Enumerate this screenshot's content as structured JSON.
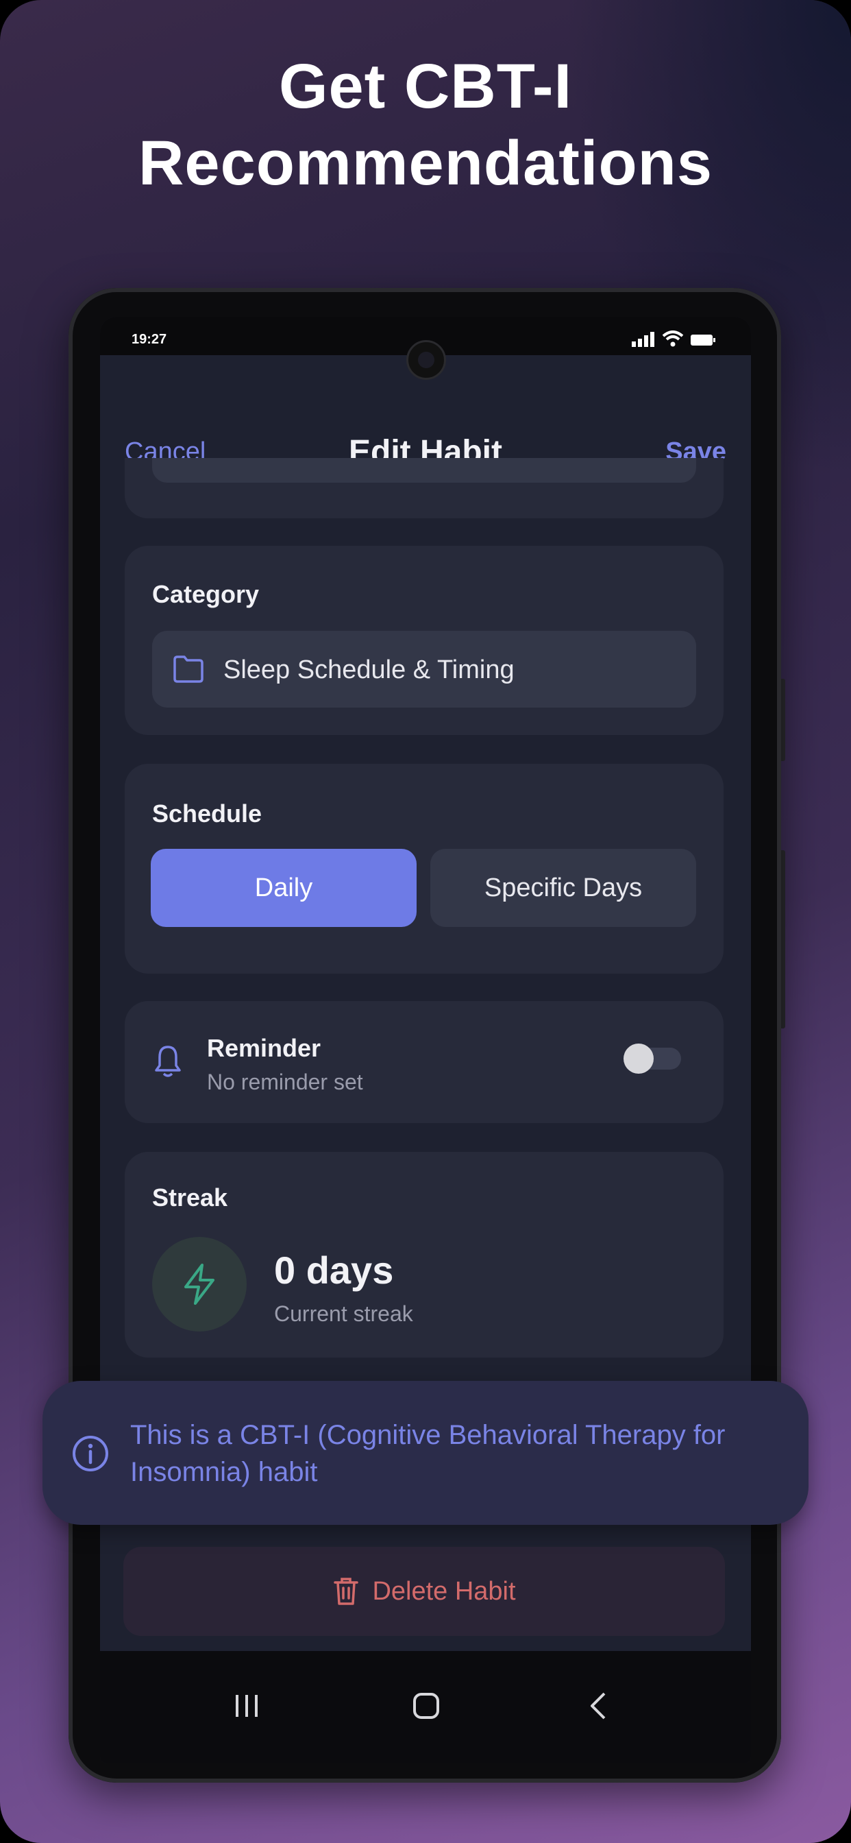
{
  "headline": {
    "line1": "Get CBT-I",
    "line2": "Recommendations"
  },
  "status_bar": {
    "time": "19:27"
  },
  "nav": {
    "cancel": "Cancel",
    "title": "Edit Habit",
    "save": "Save"
  },
  "category": {
    "title": "Category",
    "value": "Sleep Schedule & Timing",
    "icon": "folder-icon"
  },
  "schedule": {
    "title": "Schedule",
    "options": [
      "Daily",
      "Specific Days"
    ],
    "selected": "Daily"
  },
  "reminder": {
    "title": "Reminder",
    "subtitle": "No reminder set",
    "enabled": false,
    "icon": "bell-icon"
  },
  "streak": {
    "title": "Streak",
    "value": "0 days",
    "caption": "Current streak",
    "icon": "lightning-icon"
  },
  "toast": {
    "message": "This is a CBT-I (Cognitive Behavioral Therapy for Insomnia) habit",
    "icon": "info-icon"
  },
  "delete": {
    "label": "Delete Habit",
    "icon": "trash-icon"
  },
  "colors": {
    "accent": "#6e7be6",
    "danger": "#d36b6b",
    "card": "#272a3a",
    "background": "#1e2130"
  }
}
